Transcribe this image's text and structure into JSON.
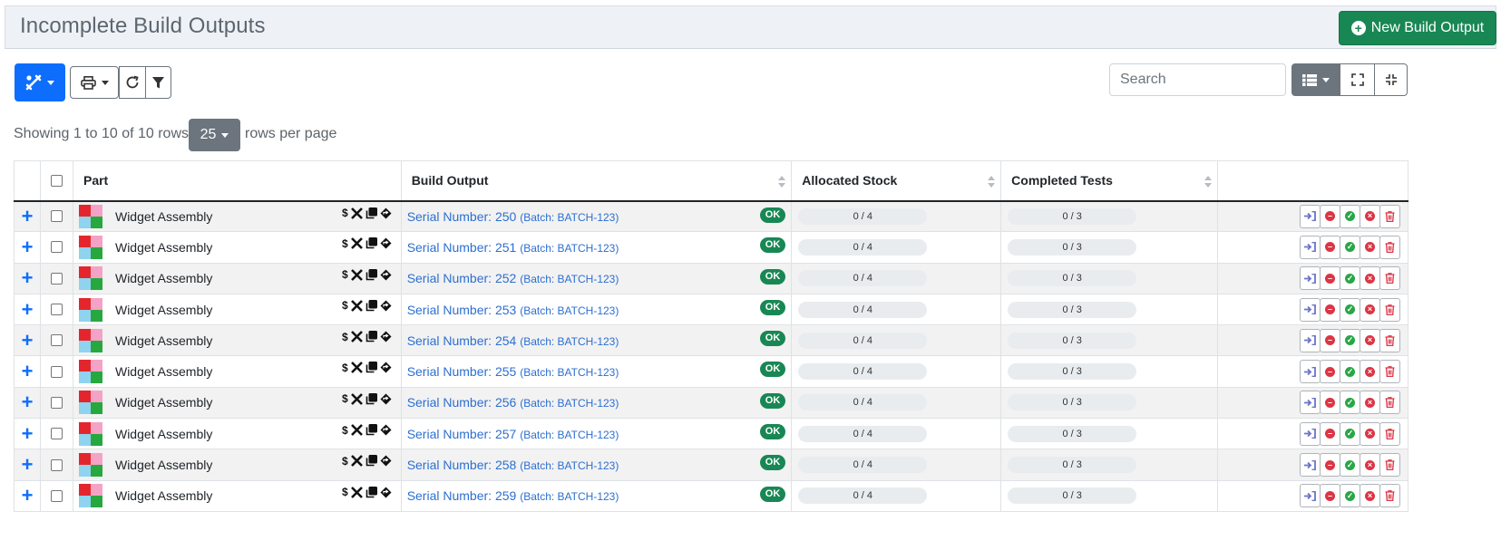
{
  "panel": {
    "title": "Incomplete Build Outputs",
    "new_button_label": "New Build Output"
  },
  "toolbar": {
    "search_placeholder": "Search"
  },
  "pagination": {
    "info": "Showing 1 to 10 of 10 rows",
    "page_size": "25",
    "page_size_suffix": "rows per page"
  },
  "table": {
    "headers": {
      "part": "Part",
      "build_output": "Build Output",
      "allocated_stock": "Allocated Stock",
      "completed_tests": "Completed Tests"
    },
    "rows": [
      {
        "part": "Widget Assembly",
        "serial": "Serial Number: 250",
        "batch": "(Batch: BATCH-123)",
        "status": "OK",
        "allocated": "0 / 4",
        "tests": "0 / 3"
      },
      {
        "part": "Widget Assembly",
        "serial": "Serial Number: 251",
        "batch": "(Batch: BATCH-123)",
        "status": "OK",
        "allocated": "0 / 4",
        "tests": "0 / 3"
      },
      {
        "part": "Widget Assembly",
        "serial": "Serial Number: 252",
        "batch": "(Batch: BATCH-123)",
        "status": "OK",
        "allocated": "0 / 4",
        "tests": "0 / 3"
      },
      {
        "part": "Widget Assembly",
        "serial": "Serial Number: 253",
        "batch": "(Batch: BATCH-123)",
        "status": "OK",
        "allocated": "0 / 4",
        "tests": "0 / 3"
      },
      {
        "part": "Widget Assembly",
        "serial": "Serial Number: 254",
        "batch": "(Batch: BATCH-123)",
        "status": "OK",
        "allocated": "0 / 4",
        "tests": "0 / 3"
      },
      {
        "part": "Widget Assembly",
        "serial": "Serial Number: 255",
        "batch": "(Batch: BATCH-123)",
        "status": "OK",
        "allocated": "0 / 4",
        "tests": "0 / 3"
      },
      {
        "part": "Widget Assembly",
        "serial": "Serial Number: 256",
        "batch": "(Batch: BATCH-123)",
        "status": "OK",
        "allocated": "0 / 4",
        "tests": "0 / 3"
      },
      {
        "part": "Widget Assembly",
        "serial": "Serial Number: 257",
        "batch": "(Batch: BATCH-123)",
        "status": "OK",
        "allocated": "0 / 4",
        "tests": "0 / 3"
      },
      {
        "part": "Widget Assembly",
        "serial": "Serial Number: 258",
        "batch": "(Batch: BATCH-123)",
        "status": "OK",
        "allocated": "0 / 4",
        "tests": "0 / 3"
      },
      {
        "part": "Widget Assembly",
        "serial": "Serial Number: 259",
        "batch": "(Batch: BATCH-123)",
        "status": "OK",
        "allocated": "0 / 4",
        "tests": "0 / 3"
      }
    ]
  },
  "icons": {
    "part_flags": [
      "dollar-icon",
      "tools-icon",
      "copy-icon",
      "directions-icon"
    ],
    "row_actions": [
      "allocate-icon",
      "deallocate-icon",
      "complete-icon",
      "scrap-icon",
      "delete-icon"
    ]
  },
  "colors": {
    "primary": "#0d6efd",
    "success": "#198754",
    "secondary": "#6c757d",
    "link": "#2c6fd1",
    "danger": "#dc3545"
  }
}
